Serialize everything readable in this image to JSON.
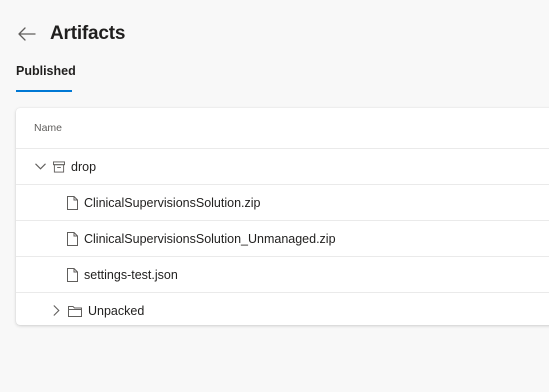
{
  "header": {
    "title": "Artifacts",
    "back_icon": "arrow-left-icon"
  },
  "tabs": [
    {
      "label": "Published",
      "selected": true
    }
  ],
  "table": {
    "column_header": "Name",
    "rows": [
      {
        "label": "drop",
        "icon": "artifact-box-icon",
        "expander": "chevron-down-icon",
        "expanded": true
      },
      {
        "label": "ClinicalSupervisionsSolution.zip",
        "icon": "file-icon"
      },
      {
        "label": "ClinicalSupervisionsSolution_Unmanaged.zip",
        "icon": "file-icon"
      },
      {
        "label": "settings-test.json",
        "icon": "file-icon"
      },
      {
        "label": "Unpacked",
        "icon": "folder-icon",
        "expander": "chevron-right-icon",
        "expanded": false
      }
    ]
  },
  "colors": {
    "accent": "#0078d4",
    "background": "#f8f8f8",
    "card": "#ffffff",
    "text": "#201f1e",
    "muted_text": "#605e5c"
  }
}
